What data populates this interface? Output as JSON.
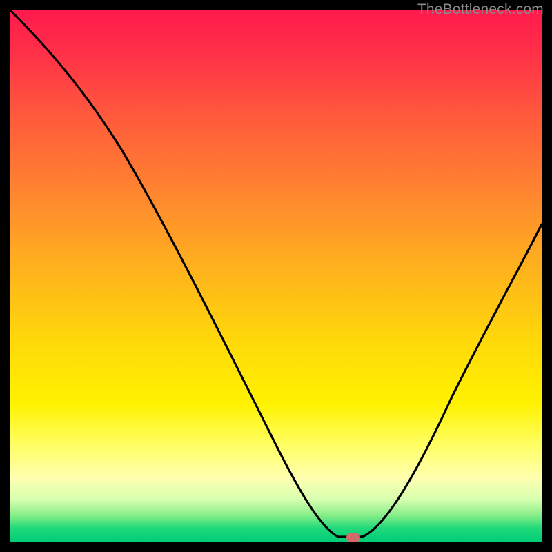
{
  "watermark": "TheBottleneck.com",
  "marker": {
    "x_pct": 64.5,
    "y_pct": 99.2
  },
  "chart_data": {
    "type": "line",
    "title": "",
    "xlabel": "",
    "ylabel": "",
    "xlim": [
      0,
      100
    ],
    "ylim": [
      0,
      100
    ],
    "series": [
      {
        "name": "bottleneck-curve",
        "x": [
          0,
          5,
          10,
          15,
          20,
          25,
          30,
          35,
          40,
          45,
          50,
          55,
          60,
          62,
          64,
          66,
          68,
          70,
          75,
          80,
          85,
          90,
          95,
          100
        ],
        "y": [
          100,
          93,
          86,
          78,
          71,
          65,
          57,
          49,
          40,
          31,
          22,
          13,
          5,
          2,
          0,
          0,
          2,
          6,
          15,
          24,
          33,
          42,
          51,
          60
        ]
      }
    ],
    "annotations": [
      {
        "kind": "marker",
        "x": 64.5,
        "y": 0.8
      }
    ],
    "background_gradient": {
      "top": "#ff1a4d",
      "mid": "#ffd80a",
      "bottom": "#00cc77"
    }
  }
}
